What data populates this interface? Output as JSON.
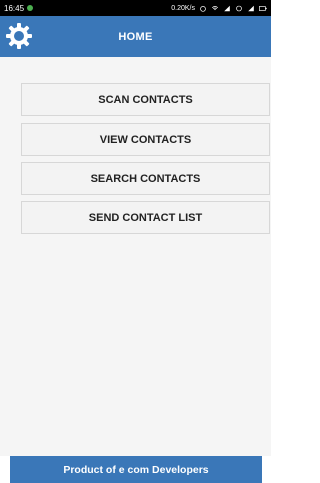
{
  "status_bar": {
    "time": "16:45",
    "network_speed": "0.20K/s"
  },
  "app_bar": {
    "title": "HOME",
    "settings_icon": "gear-icon"
  },
  "menu": {
    "buttons": [
      {
        "label": "SCAN CONTACTS"
      },
      {
        "label": "VIEW CONTACTS"
      },
      {
        "label": "SEARCH CONTACTS"
      },
      {
        "label": "SEND CONTACT LIST"
      }
    ]
  },
  "footer": {
    "text": "Product of e com Developers"
  },
  "colors": {
    "primary": "#3a77b8",
    "button_bg": "#f3f3f3",
    "button_border": "#d7d7d7"
  }
}
